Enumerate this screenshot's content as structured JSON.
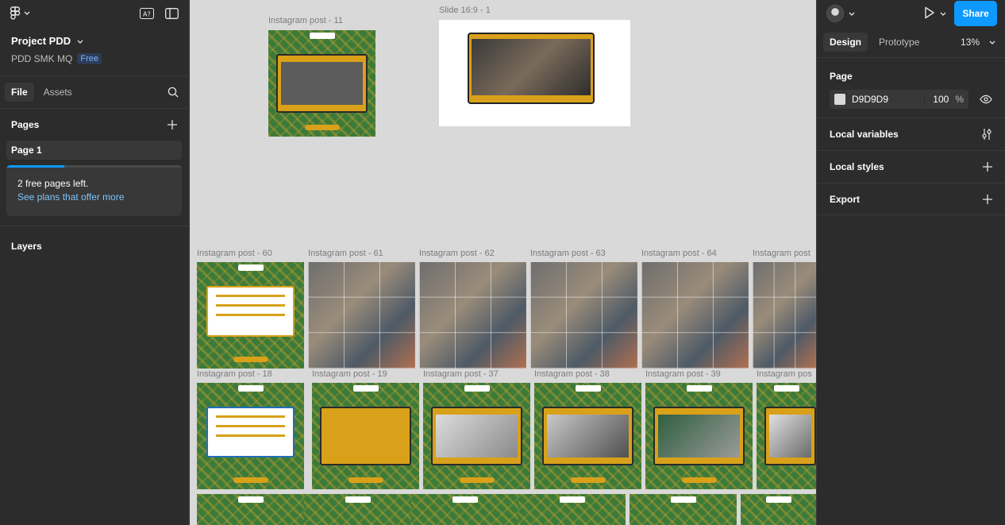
{
  "left_panel": {
    "project_title": "Project PDD",
    "team_name": "PDD SMK MQ",
    "plan_badge": "Free",
    "tabs": [
      {
        "label": "File"
      },
      {
        "label": "Assets"
      }
    ],
    "pages_heading": "Pages",
    "pages": [
      {
        "label": "Page 1"
      }
    ],
    "free_pages_text": "2 free pages left.",
    "free_pages_progress": 0.33,
    "plans_link": "See plans that offer more",
    "layers_heading": "Layers"
  },
  "canvas": {
    "background": "#d9d9d9",
    "frames": [
      {
        "label": "Instagram post - 11"
      },
      {
        "label": "Slide 16:9 - 1"
      },
      {
        "label": "Instagram post - 60"
      },
      {
        "label": "Instagram post - 61"
      },
      {
        "label": "Instagram post - 62"
      },
      {
        "label": "Instagram post - 63"
      },
      {
        "label": "Instagram post - 64"
      },
      {
        "label": "Instagram post"
      },
      {
        "label": "Instagram post - 18"
      },
      {
        "label": "Instagram post - 19"
      },
      {
        "label": "Instagram post - 37"
      },
      {
        "label": "Instagram post - 38"
      },
      {
        "label": "Instagram post - 39"
      },
      {
        "label": "Instagram pos"
      }
    ]
  },
  "right_panel": {
    "tabs": [
      {
        "label": "Design"
      },
      {
        "label": "Prototype"
      }
    ],
    "zoom": "13%",
    "share_label": "Share",
    "page_heading": "Page",
    "page_color_hex": "D9D9D9",
    "page_opacity": "100",
    "page_opacity_unit": "%",
    "rows": [
      {
        "label": "Local variables"
      },
      {
        "label": "Local styles"
      },
      {
        "label": "Export"
      }
    ]
  },
  "colors": {
    "accent": "#0d99ff",
    "panel": "#2c2c2c",
    "post_green": "#3c7a3a",
    "post_gold": "#d9a11a"
  }
}
